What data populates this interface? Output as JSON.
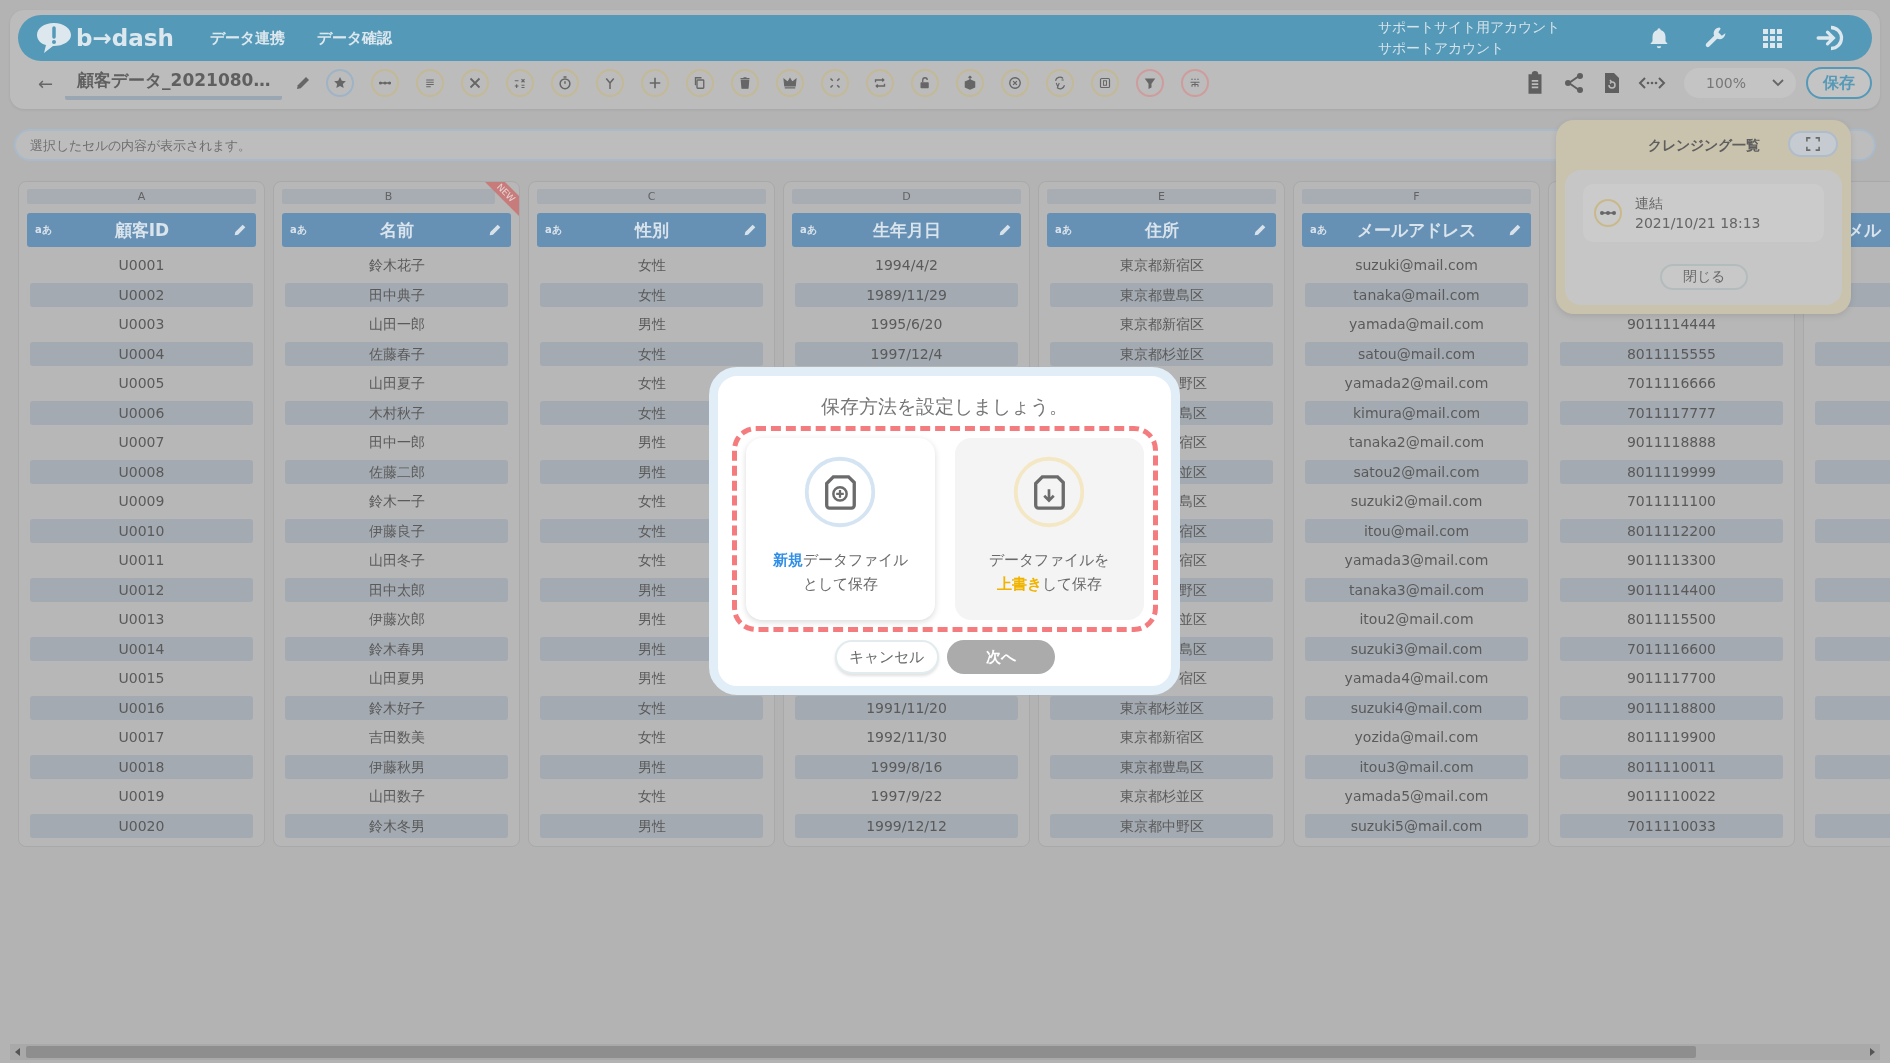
{
  "header": {
    "logo_text": "b→dash",
    "nav": [
      "データ連携",
      "データ確認"
    ],
    "account": [
      "サポートサイト用アカウント",
      "サポートアカウント"
    ]
  },
  "toolbar": {
    "back": "←",
    "file_title": "顧客データ_2021080…",
    "zoom": "100%",
    "save": "保存"
  },
  "cell_field": {
    "placeholder": "選択したセルの内容が表示されます。"
  },
  "columns": [
    {
      "letter": "A",
      "header": "顧客ID",
      "type_label": "aあ",
      "cells": [
        "U0001",
        "U0002",
        "U0003",
        "U0004",
        "U0005",
        "U0006",
        "U0007",
        "U0008",
        "U0009",
        "U0010",
        "U0011",
        "U0012",
        "U0013",
        "U0014",
        "U0015",
        "U0016",
        "U0017",
        "U0018",
        "U0019",
        "U0020"
      ]
    },
    {
      "letter": "B",
      "header": "名前",
      "type_label": "aあ",
      "badge": "NEW",
      "cells": [
        "鈴木花子",
        "田中典子",
        "山田一郎",
        "佐藤春子",
        "山田夏子",
        "木村秋子",
        "田中一郎",
        "佐藤二郎",
        "鈴木一子",
        "伊藤良子",
        "山田冬子",
        "田中太郎",
        "伊藤次郎",
        "鈴木春男",
        "山田夏男",
        "鈴木好子",
        "吉田数美",
        "伊藤秋男",
        "山田数子",
        "鈴木冬男"
      ]
    },
    {
      "letter": "C",
      "header": "性別",
      "type_label": "aあ",
      "cells": [
        "女性",
        "女性",
        "男性",
        "女性",
        "女性",
        "女性",
        "男性",
        "男性",
        "女性",
        "女性",
        "女性",
        "男性",
        "男性",
        "男性",
        "男性",
        "女性",
        "女性",
        "男性",
        "女性",
        "男性"
      ]
    },
    {
      "letter": "D",
      "header": "生年月日",
      "type_label": "aあ",
      "cells": [
        "1994/4/2",
        "1989/11/29",
        "1995/6/20",
        "1997/12/4",
        {
          "kind": "covered"
        },
        {
          "kind": "covered"
        },
        {
          "kind": "covered"
        },
        {
          "kind": "covered"
        },
        {
          "kind": "covered"
        },
        {
          "kind": "covered"
        },
        {
          "kind": "covered"
        },
        {
          "kind": "covered"
        },
        {
          "kind": "covered"
        },
        {
          "kind": "covered"
        },
        {
          "kind": "covered"
        },
        "1991/11/20",
        "1992/11/30",
        "1999/8/16",
        "1997/9/22",
        "1999/12/12"
      ]
    },
    {
      "letter": "E",
      "header": "住所",
      "type_label": "aあ",
      "cells": [
        "東京都新宿区",
        "東京都豊島区",
        "東京都新宿区",
        "東京都杉並区",
        {
          "kind": "tail",
          "text": "野区"
        },
        {
          "kind": "tail",
          "text": "島区"
        },
        {
          "kind": "tail",
          "text": "宿区"
        },
        {
          "kind": "tail",
          "text": "並区"
        },
        {
          "kind": "tail",
          "text": "島区"
        },
        {
          "kind": "tail",
          "text": "宿区"
        },
        {
          "kind": "tail",
          "text": "宿区"
        },
        {
          "kind": "tail",
          "text": "野区"
        },
        {
          "kind": "tail",
          "text": "並区"
        },
        {
          "kind": "tail",
          "text": "島区"
        },
        {
          "kind": "tail",
          "text": "宿区"
        },
        "東京都杉並区",
        "東京都新宿区",
        "東京都豊島区",
        "東京都杉並区",
        "東京都中野区"
      ]
    },
    {
      "letter": "F",
      "header": "メールアドレス",
      "type_label": "aあ",
      "cells": [
        "suzuki@mail.com",
        "tanaka@mail.com",
        "yamada@mail.com",
        "satou@mail.com",
        "yamada2@mail.com",
        "kimura@mail.com",
        "tanaka2@mail.com",
        "satou2@mail.com",
        "suzuki2@mail.com",
        "itou@mail.com",
        "yamada3@mail.com",
        "tanaka3@mail.com",
        "itou2@mail.com",
        "suzuki3@mail.com",
        "yamada4@mail.com",
        "suzuki4@mail.com",
        "yozida@mail.com",
        "itou3@mail.com",
        "yamada5@mail.com",
        "suzuki5@mail.com"
      ]
    },
    {
      "cells": [
        {
          "kind": "covered"
        },
        {
          "kind": "covered"
        },
        "9011114444",
        "8011115555",
        "7011116666",
        "7011117777",
        "9011118888",
        "8011119999",
        "7011111100",
        "8011112200",
        "9011113300",
        "9011114400",
        "8011115500",
        "7011116600",
        "9011117700",
        "9011118800",
        "8011119900",
        "8011110011",
        "9011110022",
        "7011110033"
      ]
    },
    {
      "header": "メル"
    }
  ],
  "cleansing_panel": {
    "title": "クレンジング一覧",
    "items": [
      {
        "name": "連結",
        "time": "2021/10/21 18:13"
      }
    ],
    "close": "閉じる"
  },
  "dialog": {
    "title": "保存方法を設定しましょう。",
    "options": [
      {
        "kind": "new",
        "lines": [
          [
            {
              "text": "新規",
              "accent": true
            },
            {
              "text": "データファイル",
              "accent": false
            }
          ],
          [
            {
              "text": "として保存",
              "accent": false
            }
          ]
        ]
      },
      {
        "kind": "overwrite",
        "lines": [
          [
            {
              "text": "データファイルを",
              "accent": false
            }
          ],
          [
            {
              "text": "上書き",
              "accent": true
            },
            {
              "text": "して保存",
              "accent": false
            }
          ]
        ]
      }
    ],
    "buttons": [
      {
        "label": "キャンセル",
        "disabled": false
      },
      {
        "label": "次へ",
        "disabled": true
      }
    ]
  }
}
